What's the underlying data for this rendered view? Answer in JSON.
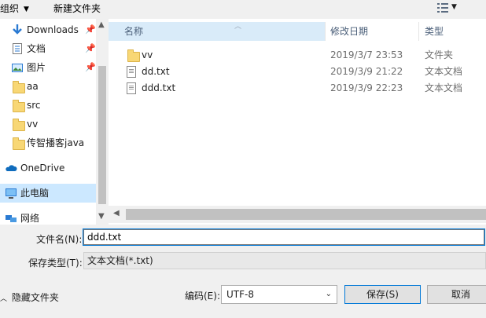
{
  "toolbar": {
    "organize_label": "组织",
    "new_folder_label": "新建文件夹"
  },
  "nav": {
    "items": [
      {
        "label": "Downloads",
        "icon": "download-arrow-icon",
        "pinned": true
      },
      {
        "label": "文档",
        "icon": "document-icon",
        "pinned": true
      },
      {
        "label": "图片",
        "icon": "picture-icon",
        "pinned": true
      },
      {
        "label": "aa",
        "icon": "folder-icon",
        "pinned": false
      },
      {
        "label": "src",
        "icon": "folder-icon",
        "pinned": false
      },
      {
        "label": "vv",
        "icon": "folder-icon",
        "pinned": false
      },
      {
        "label": "传智播客java",
        "icon": "folder-icon",
        "pinned": false
      },
      {
        "label": "OneDrive",
        "icon": "cloud-icon",
        "pinned": false
      },
      {
        "label": "此电脑",
        "icon": "computer-icon",
        "pinned": false,
        "selected": true
      },
      {
        "label": "网络",
        "icon": "network-icon",
        "pinned": false
      }
    ]
  },
  "list": {
    "columns": {
      "name": "名称",
      "date": "修改日期",
      "type": "类型"
    },
    "rows": [
      {
        "name": "vv",
        "date": "2019/3/7 23:53",
        "type": "文件夹",
        "icon": "folder-icon"
      },
      {
        "name": "dd.txt",
        "date": "2019/3/9 21:22",
        "type": "文本文档",
        "icon": "text-file-icon"
      },
      {
        "name": "ddd.txt",
        "date": "2019/3/9 22:23",
        "type": "文本文档",
        "icon": "text-file-icon"
      }
    ]
  },
  "form": {
    "filename_label": "文件名(N):",
    "filename_value": "ddd.txt",
    "filetype_label": "保存类型(T):",
    "filetype_value": "文本文档(*.txt)",
    "hide_folders_label": "隐藏文件夹",
    "encoding_label": "编码(E):",
    "encoding_value": "UTF-8",
    "save_label": "保存(S)",
    "cancel_label": "取消"
  },
  "colors": {
    "accent": "#0078d7",
    "selected_bg": "#cce8ff",
    "header_hover": "#d9ebf9",
    "folder": "#f8d775"
  }
}
